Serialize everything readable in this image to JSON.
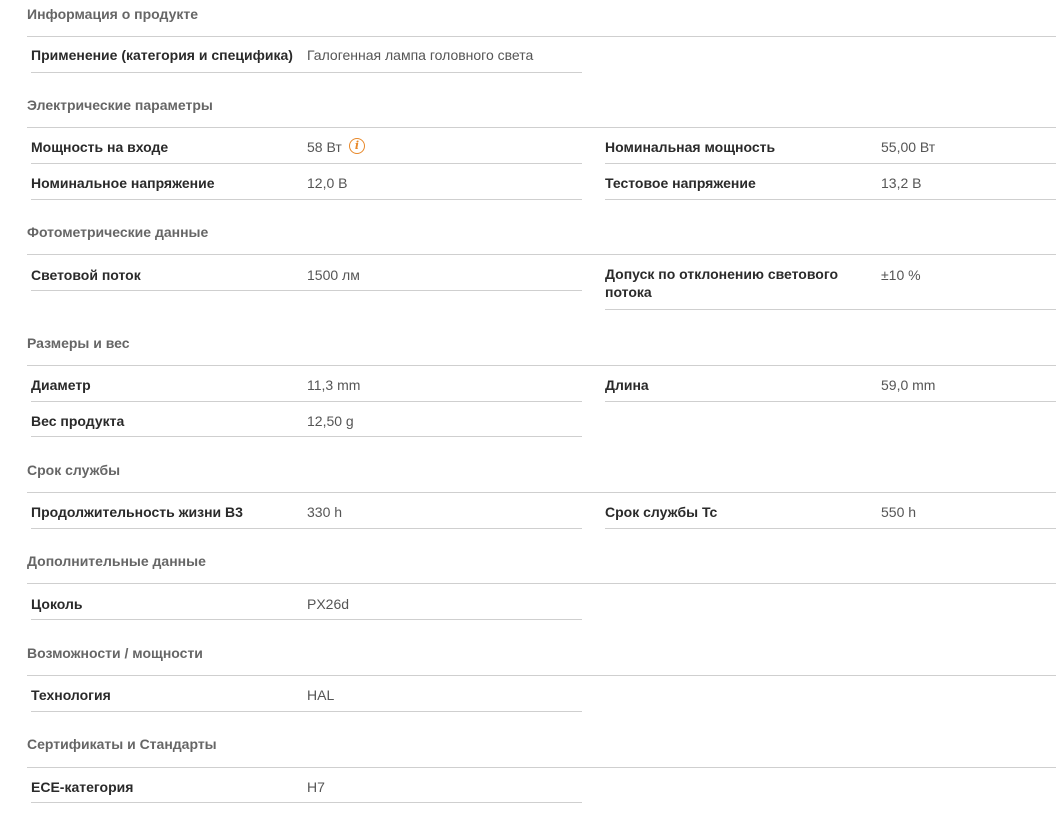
{
  "sections": {
    "product_info": {
      "title": "Информация о продукте",
      "application": {
        "label": "Применение (категория и специфика)",
        "value": "Галогенная лампа головного света"
      }
    },
    "electrical": {
      "title": "Электрические параметры",
      "input_power": {
        "label": "Мощность на входе",
        "value": "58 Вт"
      },
      "nominal_power": {
        "label": "Номинальная мощность",
        "value": "55,00 Вт"
      },
      "nominal_voltage": {
        "label": "Номинальное напряжение",
        "value": "12,0 В"
      },
      "test_voltage": {
        "label": "Тестовое напряжение",
        "value": "13,2 В"
      }
    },
    "photometric": {
      "title": "Фотометрические данные",
      "luminous_flux": {
        "label": "Световой поток",
        "value": "1500 лм"
      },
      "flux_tolerance": {
        "label": "Допуск по отклонению светового потока",
        "value": "±10 %"
      }
    },
    "dimensions": {
      "title": "Размеры и вес",
      "diameter": {
        "label": "Диаметр",
        "value": "11,3 mm"
      },
      "length": {
        "label": "Длина",
        "value": "59,0 mm"
      },
      "weight": {
        "label": "Вес продукта",
        "value": "12,50 g"
      }
    },
    "lifetime": {
      "title": "Срок службы",
      "life_b3": {
        "label": "Продолжительность жизни B3",
        "value": "330 h"
      },
      "life_tc": {
        "label": "Срок службы Tc",
        "value": "550 h"
      }
    },
    "additional": {
      "title": "Дополнительные данные",
      "base": {
        "label": "Цоколь",
        "value": "PX26d"
      }
    },
    "capabilities": {
      "title": "Возможности / мощности",
      "technology": {
        "label": "Технология",
        "value": "HAL"
      }
    },
    "certificates": {
      "title": "Сертификаты и Стандарты",
      "ece": {
        "label": "ECE-категория",
        "value": "H7"
      }
    }
  },
  "icons": {
    "info": {
      "name": "info-icon",
      "glyph": "i",
      "color": "#e8892b"
    }
  }
}
